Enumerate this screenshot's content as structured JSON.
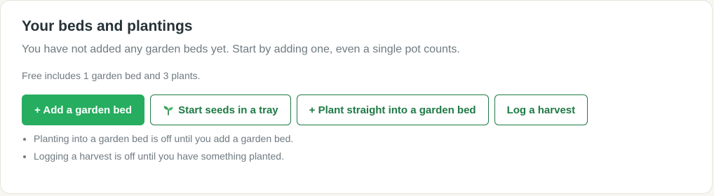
{
  "section": {
    "title": "Your beds and plantings",
    "subtitle": "You have not added any garden beds yet. Start by adding one, even a single pot counts.",
    "plan_note": "Free includes 1 garden bed and 3 plants."
  },
  "actions": {
    "add_bed": "+ Add a garden bed",
    "start_seeds": "Start seeds in a tray",
    "start_seeds_icon": "sprout-icon",
    "plant_direct": "+ Plant straight into a garden bed",
    "log_harvest": "Log a harvest"
  },
  "disabled_notes": [
    "Planting into a garden bed is off until you add a garden bed.",
    "Logging a harvest is off until you have something planted."
  ],
  "colors": {
    "accent": "#26ad5f",
    "accent_dark": "#1e7a45",
    "title": "#263238",
    "muted": "#6f7a80"
  }
}
